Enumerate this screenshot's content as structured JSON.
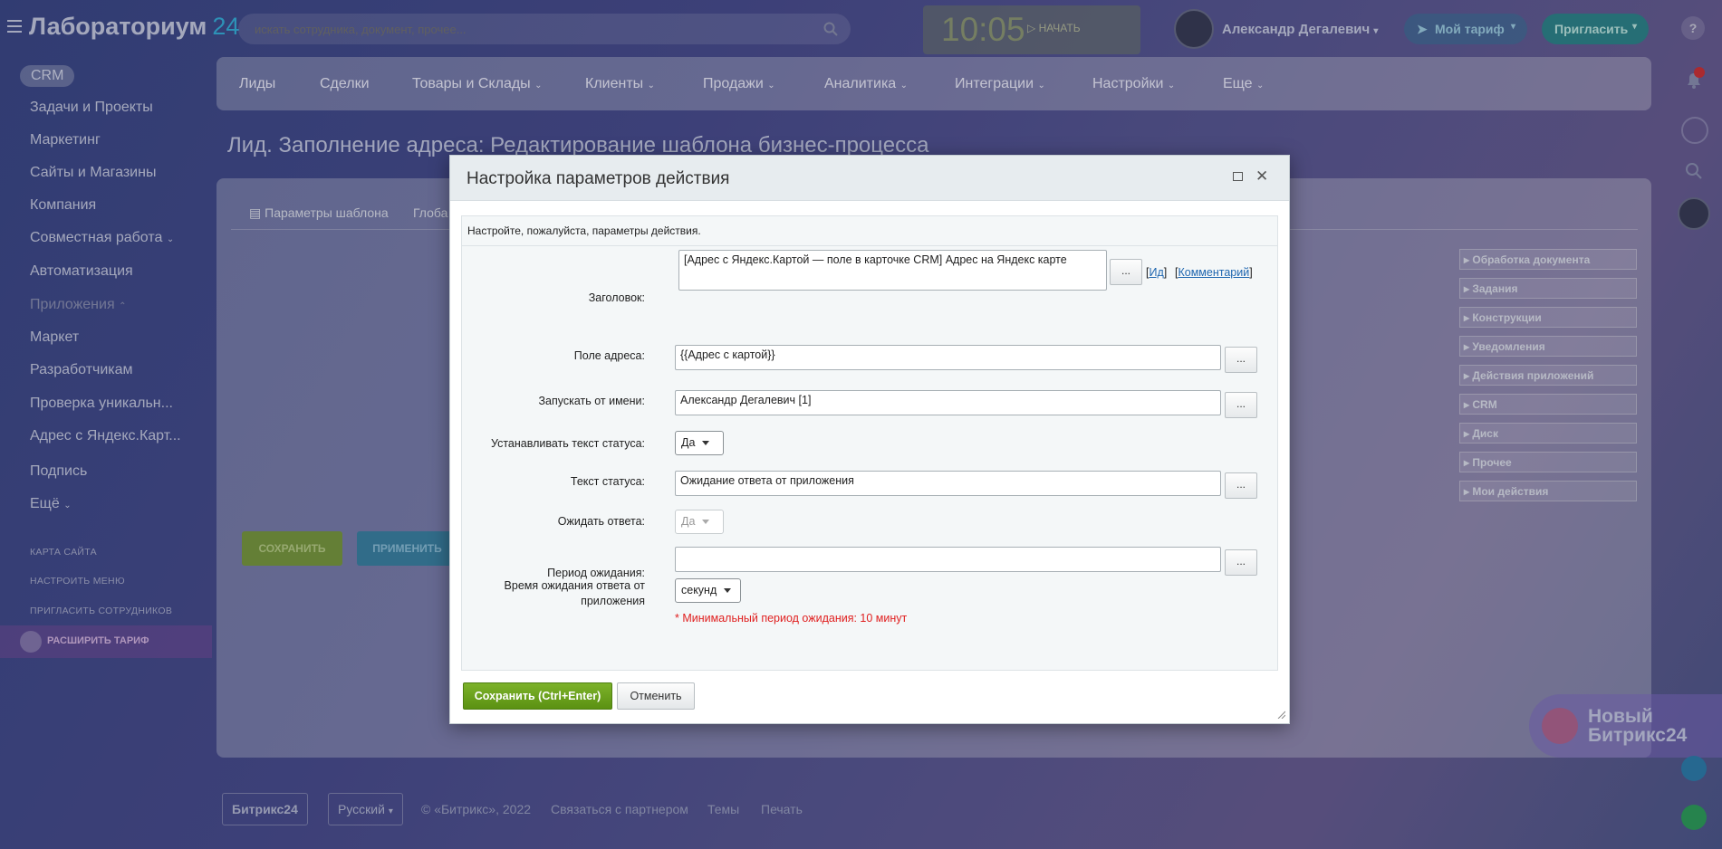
{
  "topbar": {
    "logo": "Лабораториум",
    "logo_num": "24",
    "search_placeholder": "искать сотрудника, документ, прочее...",
    "time": "10:05",
    "start_label": "НАЧАТЬ",
    "user_name": "Александр Дегалевич",
    "tariff_label": "Мой тариф",
    "invite_label": "Пригласить",
    "help": "?"
  },
  "sidebar": {
    "crm": "CRM",
    "items": [
      "Задачи и Проекты",
      "Маркетинг",
      "Сайты и Магазины",
      "Компания",
      "Совместная работа",
      "Автоматизация",
      "Приложения",
      "Маркет",
      "Разработчикам",
      "Проверка уникальн...",
      "Адрес с Яндекс.Карт...",
      "Подпись",
      "Ещё"
    ],
    "small_links": [
      "КАРТА САЙТА",
      "НАСТРОИТЬ МЕНЮ",
      "ПРИГЛАСИТЬ СОТРУДНИКОВ"
    ],
    "upgrade": "РАСШИРИТЬ ТАРИФ"
  },
  "nav": [
    "Лиды",
    "Сделки",
    "Товары и Склады",
    "Клиенты",
    "Продажи",
    "Аналитика",
    "Интеграции",
    "Настройки",
    "Еще"
  ],
  "page_title": "Лид. Заполнение адреса: Редактирование шаблона бизнес-процесса",
  "tabs": [
    "Параметры шаблона",
    "Глоба"
  ],
  "bg_buttons": {
    "save": "СОХРАНИТЬ",
    "apply": "ПРИМЕНИТЬ"
  },
  "toolbox": [
    "Обработка документа",
    "Задания",
    "Конструкции",
    "Уведомления",
    "Действия приложений",
    "CRM",
    "Диск",
    "Прочее",
    "Мои действия"
  ],
  "footer": {
    "brand": "Битрикс24",
    "lang": "Русский",
    "copyright": "© «Битрикс», 2022",
    "partner": "Связаться с партнером",
    "themes": "Темы",
    "print": "Печать"
  },
  "new_b24": {
    "line1": "Новый",
    "line2": "Битрикс24"
  },
  "dialog": {
    "title": "Настройка параметров действия",
    "hint": "Настройте, пожалуйста, параметры действия.",
    "fields": {
      "title_label": "Заголовок:",
      "title_value": "[Адрес с Яндекс.Картой — поле в карточке CRM] Адрес на Яндекс карте",
      "id_link": "Ид",
      "comment_link": "Комментарий",
      "address_label": "Поле адреса:",
      "address_value": "{{Адрес с картой}}",
      "run_as_label": "Запускать от имени:",
      "run_as_value": "Александр Дегалевич [1]",
      "set_status_label": "Устанавливать текст статуса:",
      "set_status_value": "Да",
      "status_text_label": "Текст статуса:",
      "status_text_value": "Ожидание ответа от приложения",
      "wait_label": "Ожидать ответа:",
      "wait_value": "Да",
      "period_label": "Период ожидания:",
      "period_sub": "Время ожидания ответа от приложения",
      "period_value": "",
      "period_unit": "секунд",
      "warning": "* Минимальный период ожидания: 10 минут",
      "dots": "..."
    },
    "save_button": "Сохранить (Ctrl+Enter)",
    "cancel_button": "Отменить"
  }
}
